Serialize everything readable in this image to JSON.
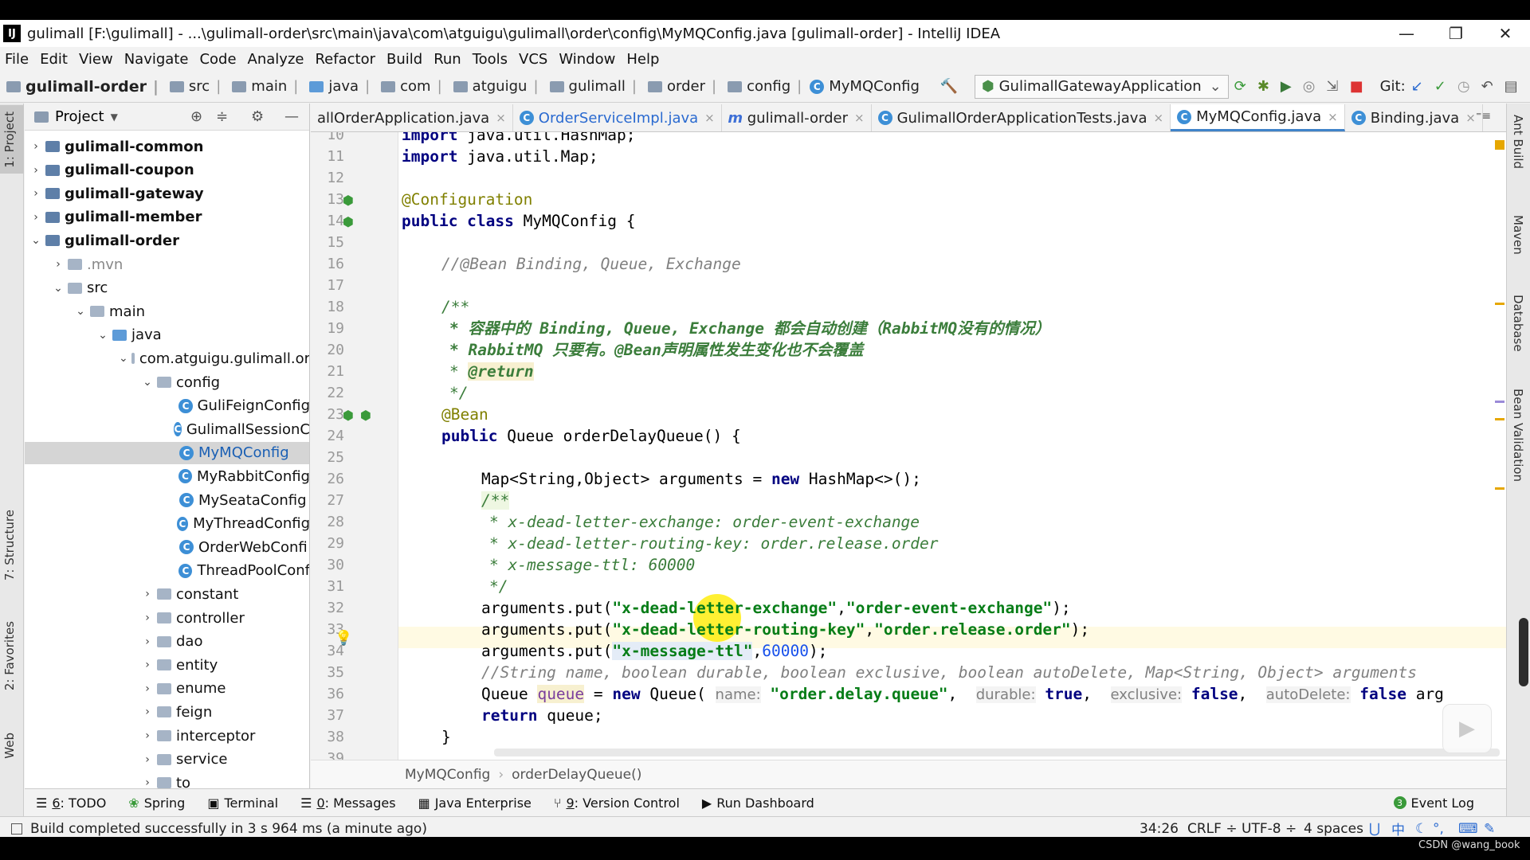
{
  "window": {
    "title": "gulimall [F:\\gulimall] - ...\\gulimall-order\\src\\main\\java\\com\\atguigu\\gulimall\\order\\config\\MyMQConfig.java [gulimall-order] - IntelliJ IDEA",
    "app_icon": "IJ",
    "minimize": "—",
    "restore": "❐",
    "close": "✕"
  },
  "menu": [
    "File",
    "Edit",
    "View",
    "Navigate",
    "Code",
    "Analyze",
    "Refactor",
    "Build",
    "Run",
    "Tools",
    "VCS",
    "Window",
    "Help"
  ],
  "nav": {
    "crumbs": [
      "gulimall-order",
      "src",
      "main",
      "java",
      "com",
      "atguigu",
      "gulimall",
      "order",
      "config",
      "MyMQConfig"
    ],
    "run_config": "GulimallGatewayApplication",
    "git_label": "Git:"
  },
  "left_strip": {
    "project": "1: Project",
    "structure": "7: Structure",
    "favorites": "2: Favorites",
    "web": "Web"
  },
  "right_strip": {
    "ant": "Ant Build",
    "maven": "Maven",
    "database": "Database",
    "bean": "Bean Validation"
  },
  "project_panel": {
    "title": "Project",
    "items": [
      {
        "label": "gulimall-common",
        "bold": true,
        "level": 0,
        "arrow": "›",
        "icon": "module"
      },
      {
        "label": "gulimall-coupon",
        "bold": true,
        "level": 0,
        "arrow": "›",
        "icon": "module"
      },
      {
        "label": "gulimall-gateway",
        "bold": true,
        "level": 0,
        "arrow": "›",
        "icon": "module"
      },
      {
        "label": "gulimall-member",
        "bold": true,
        "level": 0,
        "arrow": "›",
        "icon": "module"
      },
      {
        "label": "gulimall-order",
        "bold": true,
        "level": 0,
        "arrow": "⌄",
        "icon": "module"
      },
      {
        "label": ".mvn",
        "level": 1,
        "arrow": "›",
        "icon": "folder",
        "muted": true
      },
      {
        "label": "src",
        "level": 1,
        "arrow": "⌄",
        "icon": "folder"
      },
      {
        "label": "main",
        "level": 2,
        "arrow": "⌄",
        "icon": "folder"
      },
      {
        "label": "java",
        "level": 3,
        "arrow": "⌄",
        "icon": "folder-blue"
      },
      {
        "label": "com.atguigu.gulimall.or",
        "level": 4,
        "arrow": "⌄",
        "icon": "folder"
      },
      {
        "label": "config",
        "level": 5,
        "arrow": "⌄",
        "icon": "folder"
      },
      {
        "label": "GuliFeignConfig",
        "level": 6,
        "icon": "class"
      },
      {
        "label": "GulimallSessionC",
        "level": 6,
        "icon": "class"
      },
      {
        "label": "MyMQConfig",
        "level": 6,
        "icon": "class",
        "selected": true
      },
      {
        "label": "MyRabbitConfig",
        "level": 6,
        "icon": "class"
      },
      {
        "label": "MySeataConfig",
        "level": 6,
        "icon": "class"
      },
      {
        "label": "MyThreadConfig",
        "level": 6,
        "icon": "class"
      },
      {
        "label": "OrderWebConfi",
        "level": 6,
        "icon": "class"
      },
      {
        "label": "ThreadPoolConf",
        "level": 6,
        "icon": "class"
      },
      {
        "label": "constant",
        "level": 5,
        "arrow": "›",
        "icon": "folder"
      },
      {
        "label": "controller",
        "level": 5,
        "arrow": "›",
        "icon": "folder"
      },
      {
        "label": "dao",
        "level": 5,
        "arrow": "›",
        "icon": "folder"
      },
      {
        "label": "entity",
        "level": 5,
        "arrow": "›",
        "icon": "folder"
      },
      {
        "label": "enume",
        "level": 5,
        "arrow": "›",
        "icon": "folder"
      },
      {
        "label": "feign",
        "level": 5,
        "arrow": "›",
        "icon": "folder"
      },
      {
        "label": "interceptor",
        "level": 5,
        "arrow": "›",
        "icon": "folder"
      },
      {
        "label": "service",
        "level": 5,
        "arrow": "›",
        "icon": "folder"
      },
      {
        "label": "to",
        "level": 5,
        "arrow": "›",
        "icon": "folder"
      }
    ]
  },
  "tabs": [
    {
      "label": "allOrderApplication.java",
      "icon": "class",
      "close": "×"
    },
    {
      "label": "OrderServiceImpl.java",
      "icon": "class",
      "close": "×",
      "link": true
    },
    {
      "label": "gulimall-order",
      "icon": "maven",
      "close": "×"
    },
    {
      "label": "GulimallOrderApplicationTests.java",
      "icon": "class",
      "close": "×"
    },
    {
      "label": "MyMQConfig.java",
      "icon": "class",
      "close": "×",
      "active": true
    },
    {
      "label": "Binding.java",
      "icon": "class",
      "close": "×"
    }
  ],
  "tabs_overflow": "⁼≡",
  "code": {
    "line_numbers": [
      "10",
      "11",
      "12",
      "13",
      "14",
      "15",
      "16",
      "17",
      "18",
      "19",
      "20",
      "21",
      "22",
      "23",
      "24",
      "25",
      "26",
      "27",
      "28",
      "29",
      "30",
      "31",
      "32",
      "33",
      "34",
      "35",
      "36",
      "37",
      "38",
      "39"
    ],
    "tokens": {
      "l10": [
        "import",
        " java.util.HashMap;"
      ],
      "l11": [
        "import",
        " java.util.Map;"
      ],
      "l13": "@Configuration",
      "l14": [
        "public class",
        " MyMQConfig {"
      ],
      "l16": "//@Bean Binding, Queue, Exchange",
      "l18": "/**",
      "l19": "* 容器中的 Binding, Queue, Exchange 都会自动创建（RabbitMQ没有的情况）",
      "l20": "* RabbitMQ 只要有。@Bean声明属性发生变化也不会覆盖",
      "l21a": "* ",
      "l21b": "@return",
      "l22": "*/",
      "l23": "@Bean",
      "l24": [
        "public",
        " Queue orderDelayQueue() {"
      ],
      "l26a": "Map<String,Object> arguments = ",
      "l26b": "new",
      "l26c": " HashMap<>();",
      "l27": "/**",
      "l28": "* x-dead-letter-exchange: order-event-exchange",
      "l29": "* x-dead-letter-routing-key: order.release.order",
      "l30": "* x-message-ttl: 60000",
      "l31": "*/",
      "l32a": "arguments.put(",
      "l32b": "\"x-dead-letter-exchange\"",
      "l32c": ",",
      "l32d": "\"order-event-exchange\"",
      "l32e": ");",
      "l33a": "arguments.put(",
      "l33b": "\"x-dead-letter-routing-key\"",
      "l33c": ",",
      "l33d": "\"order.release.order\"",
      "l33e": ");",
      "l34a": "arguments.put(",
      "l34b": "\"x-message-ttl\"",
      "l34c": ",",
      "l34d": "60000",
      "l34e": ");",
      "l35": "//String name, boolean durable, boolean exclusive, boolean autoDelete, Map<String, Object> arguments",
      "l36a": "Queue ",
      "l36b": "queue",
      "l36c": " = ",
      "l36d": "new",
      "l36e": " Queue( ",
      "l36h1": "name:",
      "l36s1": "\"order.delay.queue\"",
      "l36h2": "durable:",
      "l36v2": "true",
      "l36h3": "exclusive:",
      "l36v3": "false",
      "l36h4": "autoDelete:",
      "l36v4": "false",
      "l36tail": " arg",
      "l37a": "return",
      "l37b": " queue;",
      "l38": "}"
    }
  },
  "editor_breadcrumb": [
    "MyMQConfig",
    "orderDelayQueue()"
  ],
  "tool_windows": [
    {
      "key": "6",
      "label": ": TODO",
      "icon": "todo-icon"
    },
    {
      "label": "Spring",
      "icon": "spring-icon"
    },
    {
      "label": "Terminal",
      "icon": "terminal-icon"
    },
    {
      "key": "0",
      "label": ": Messages",
      "icon": "messages-icon"
    },
    {
      "label": "Java Enterprise",
      "icon": "java-enterprise-icon"
    },
    {
      "key": "9",
      "label": ": Version Control",
      "icon": "version-control-icon"
    },
    {
      "label": "Run Dashboard",
      "icon": "run-dashboard-icon"
    }
  ],
  "event_log": {
    "badge": "3",
    "label": "Event Log"
  },
  "status": {
    "message": "Build completed successfully in 3 s 964 ms (a minute ago)",
    "position": "34:26",
    "line_sep": "CRLF ÷",
    "encoding": "UTF-8 ÷",
    "indent": "4 spaces",
    "ime": "中"
  },
  "watermark": "CSDN @wang_book",
  "colors": {
    "accent": "#4083c9",
    "selection": "#d5d5d5",
    "highlight": "#ffec00"
  }
}
